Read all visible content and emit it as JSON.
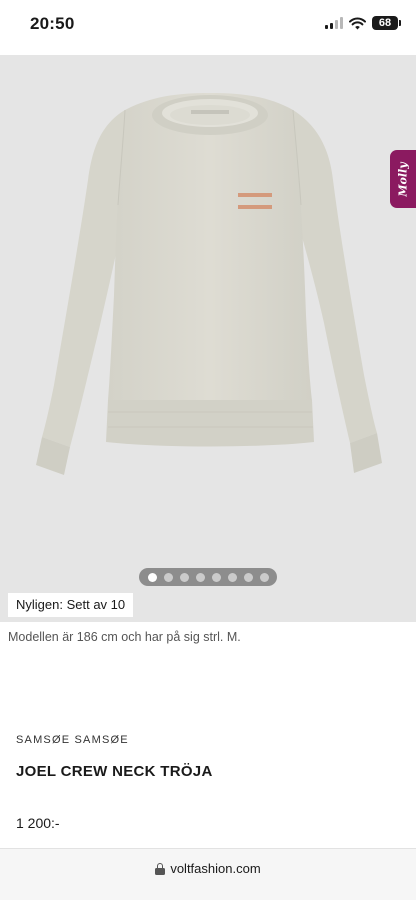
{
  "status_bar": {
    "time": "20:50",
    "battery": "68"
  },
  "hero": {
    "image": "cream crew neck sweatshirt",
    "product_color": "#dcdbd2",
    "background": "#e5e5e5",
    "carousel": {
      "total": 8,
      "active": 1
    },
    "recent_badge": "Nyligen: Sett av 10"
  },
  "molly_tab": {
    "label": "Molly",
    "color": "#8b1a60"
  },
  "model_note": "Modellen är 186 cm och har på sig strl. M.",
  "product": {
    "brand": "SAMSØE SAMSØE",
    "title": "JOEL CREW NECK TRÖJA",
    "price": "1 200:-"
  },
  "browser": {
    "url": "voltfashion.com"
  }
}
